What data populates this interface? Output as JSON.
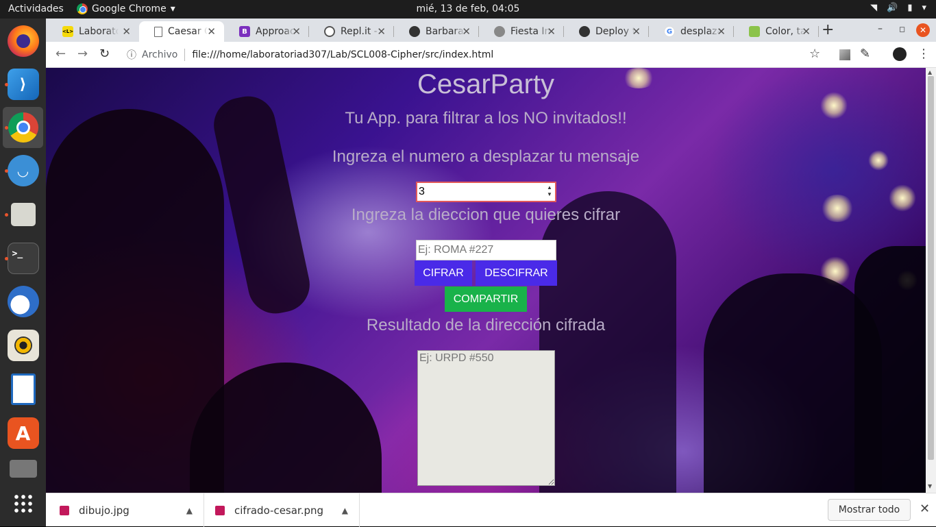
{
  "topbar": {
    "activities": "Actividades",
    "app_name": "Google Chrome",
    "clock": "mié, 13 de feb, 04:05"
  },
  "dock": {
    "items": [
      {
        "name": "firefox",
        "icon": "firefox-icon"
      },
      {
        "name": "vscode",
        "icon": "vscode-icon"
      },
      {
        "name": "chrome",
        "icon": "chrome-icon"
      },
      {
        "name": "kazam",
        "icon": "screenshot-icon"
      },
      {
        "name": "files",
        "icon": "folder-icon"
      },
      {
        "name": "terminal",
        "icon": "terminal-icon",
        "label": ">_"
      },
      {
        "name": "thunderbird",
        "icon": "mail-icon"
      },
      {
        "name": "rhythmbox",
        "icon": "music-icon"
      },
      {
        "name": "writer",
        "icon": "document-icon"
      },
      {
        "name": "software",
        "icon": "software-icon",
        "label": "A"
      },
      {
        "name": "drive",
        "icon": "drive-icon"
      }
    ],
    "apps_grid": "apps-grid-icon"
  },
  "tabs": [
    {
      "title": "Laborato",
      "fav_color": "#f5d90a",
      "fav_text": "<L>"
    },
    {
      "title": "Caesar C",
      "fav_color": "#ffffff",
      "fav_text": "",
      "active": true
    },
    {
      "title": "Approac",
      "fav_color": "#7b2fbe",
      "fav_text": "B"
    },
    {
      "title": "Repl.it - F",
      "fav_color": "#555555",
      "fav_text": ""
    },
    {
      "title": "Barbarat",
      "fav_color": "#333333",
      "fav_text": ""
    },
    {
      "title": "Fiesta Im",
      "fav_color": "#555555",
      "fav_text": ""
    },
    {
      "title": "Deploy t",
      "fav_color": "#333333",
      "fav_text": ""
    },
    {
      "title": "desplaza",
      "fav_color": "#4285f4",
      "fav_text": "G"
    },
    {
      "title": "Color, ta",
      "fav_color": "#8bc34a",
      "fav_text": ""
    }
  ],
  "toolbar": {
    "scheme": "Archivo",
    "url": "file:///home/laboratoriad307/Lab/SCL008-Cipher/src/index.html"
  },
  "page": {
    "title": "CesarParty",
    "tagline": "Tu App. para filtrar a los NO invitados!!",
    "shift_label": "Ingreza el numero a desplazar tu mensaje",
    "shift_value": "3",
    "message_label": "Ingreza la dieccion que quieres cifrar",
    "message_placeholder": "Ej: ROMA #227",
    "cipher_button": "CIFRAR",
    "decipher_button": "DESCIFRAR",
    "share_button": "COMPARTIR",
    "result_label": "Resultado de la dirección cifrada",
    "result_placeholder": "Ej: URPD #550"
  },
  "downloads": {
    "items": [
      {
        "name": "dibujo.jpg"
      },
      {
        "name": "cifrado-cesar.png"
      }
    ],
    "show_all": "Mostrar todo"
  },
  "colors": {
    "button_blue": "#4a2ae8",
    "button_green": "#19b24a",
    "ubuntu_orange": "#e95420"
  }
}
